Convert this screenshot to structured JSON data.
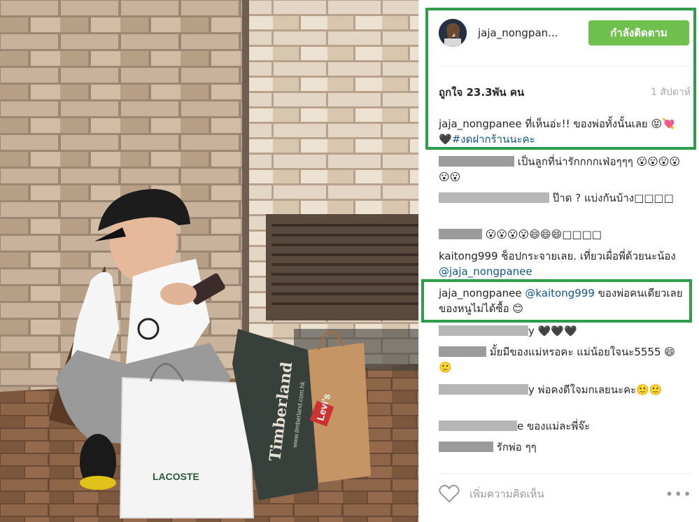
{
  "post": {
    "username": "jaja_nongpan...",
    "follow_label": "กำลังติดตาม",
    "likes": "ถูกใจ 23.3พัน คน",
    "time": "1 สัปดาห์",
    "caption": {
      "username": "jaja_nongpanee",
      "text": " ที่เห็นอ่ะ!! ของพ่อทั้งนั้นเลย 😝💘🖤",
      "hashtag": "#งดฝากร้านนะคะ"
    }
  },
  "comments": [
    {
      "text": " เป็นลูกที่น่ารักกกกเฟ่อๆๆๆ 😮😮😮😮😮😮"
    },
    {
      "text": " ป๊าด ? แบ่งกันบ้าง□□□□"
    },
    {
      "text": " 😮😮😮😮😄😄😄□□□□"
    },
    {
      "user": "kaitong999",
      "text": " ช็อปกระจายเลย. เที่ยวเผื่อพี่ด้วยนะน้อง ",
      "mention": "@jaja_nongpanee"
    },
    {
      "user": "jaja_nongpanee",
      "mention": "@kaitong999",
      "text": " ของพ่อคนเดียวเลย ของหนูไม่ได้ซื้อ 😊"
    },
    {
      "text": "y 🖤🖤🖤"
    },
    {
      "text": " มั้ยมีของแม่หรอคะ แม่น้อยใจนะ5555 😄🙂"
    },
    {
      "text": "y พ่อคงดีใจมกเลยนะคะ🙂🙂"
    },
    {
      "text": "e ของแม่ละพี่จ๊ะ"
    },
    {
      "text": " รักพ่อ ๆๆ"
    }
  ],
  "footer": {
    "add_comment_placeholder": "เพิ่มความคิดเห็น",
    "more": "•••"
  },
  "photo": {
    "bag_brand_1": "LACOSTE",
    "bag_brand_2": "Timberland",
    "bag_brand_2_url": "www.timberland.com.hk",
    "bag_brand_3": "Levi's"
  },
  "colors": {
    "follow_bg": "#70c050",
    "highlight": "#2e9e4a",
    "link": "#125688"
  }
}
